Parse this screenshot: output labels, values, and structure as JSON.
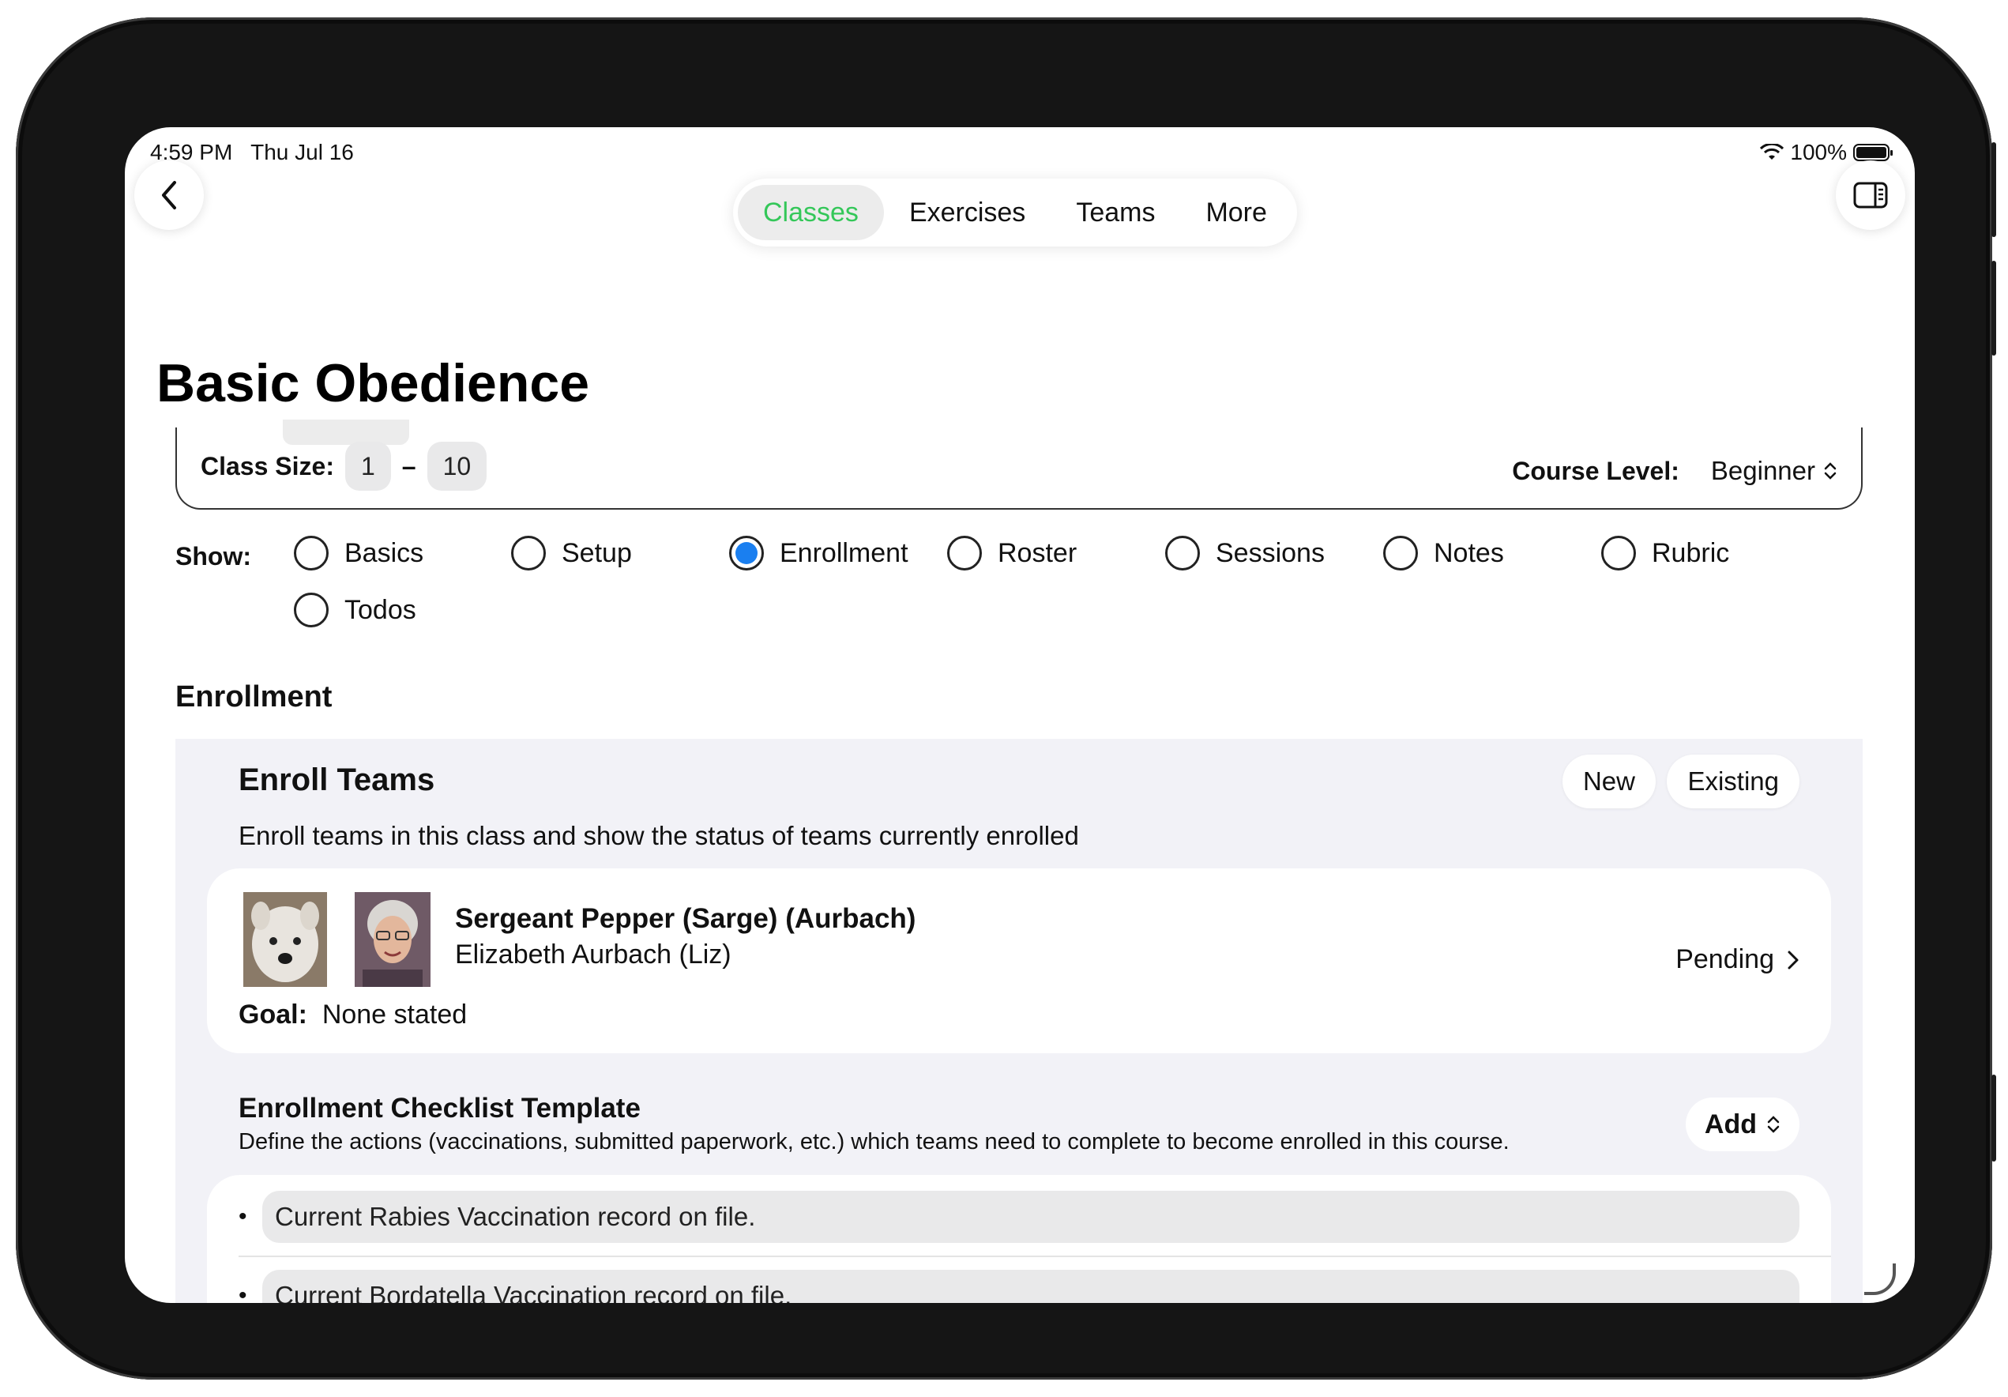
{
  "status_bar": {
    "time": "4:59 PM",
    "date": "Thu Jul 16",
    "battery": "100%"
  },
  "nav": {
    "tabs": [
      {
        "label": "Classes",
        "active": true
      },
      {
        "label": "Exercises",
        "active": false
      },
      {
        "label": "Teams",
        "active": false
      },
      {
        "label": "More",
        "active": false
      }
    ],
    "accent_color": "#34c759"
  },
  "page_title": "Basic Obedience",
  "setup": {
    "class_size_label": "Class Size:",
    "class_size_min": "1",
    "class_size_sep": "–",
    "class_size_max": "10",
    "course_level_label": "Course Level:",
    "course_level_value": "Beginner"
  },
  "show": {
    "label": "Show:",
    "options": [
      "Basics",
      "Setup",
      "Enrollment",
      "Roster",
      "Sessions",
      "Notes",
      "Rubric",
      "Todos"
    ],
    "selected": "Enrollment"
  },
  "enrollment": {
    "heading": "Enrollment",
    "enroll_teams_title": "Enroll Teams",
    "new_label": "New",
    "existing_label": "Existing",
    "description": "Enroll teams in this class and show the status of teams currently enrolled",
    "team": {
      "dog_name": "Sergeant Pepper (Sarge) (Aurbach)",
      "handler": "Elizabeth Aurbach  (Liz)",
      "goal_label": "Goal:",
      "goal_value": "None stated",
      "status": "Pending"
    },
    "checklist": {
      "title": "Enrollment Checklist Template",
      "description": "Define the actions (vaccinations, submitted paperwork, etc.) which teams need to complete to become enrolled in this course.",
      "add_label": "Add",
      "items": [
        "Current Rabies Vaccination record on file.",
        "Current Bordatella Vaccination record on file."
      ]
    }
  }
}
